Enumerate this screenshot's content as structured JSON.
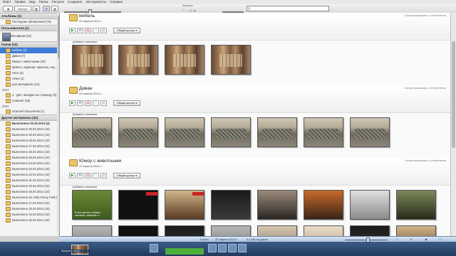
{
  "menu": [
    "Файл",
    "Правка",
    "Вид",
    "Папка",
    "Рисунок",
    "Создание",
    "Инструменты",
    "Справка"
  ],
  "toolbar": {
    "import_label": "Импорт",
    "filters_label": "Фильтры",
    "search_placeholder": ""
  },
  "sidebar": {
    "albums_header": "Альбомы (1)",
    "albums": [
      {
        "label": "Последние обновления (75)"
      }
    ],
    "people_header": "Пользователи (1)",
    "person": "Без имени (41)",
    "folders_header": "Папки (10)",
    "folders_2014": [
      {
        "label": "мебель (4)",
        "selected": true
      },
      {
        "label": "Диван (7)"
      },
      {
        "label": "Юмор с животными (40)"
      },
      {
        "label": "фейлы, падения, приколы, неу..."
      },
      {
        "label": "Ночь (4)"
      },
      {
        "label": "Vines (1)"
      },
      {
        "label": "доп материалы (21)"
      }
    ],
    "year_2013": "2013",
    "folders_2013": [
      {
        "label": "4 - Доп. вкладки на страницу (5)"
      },
      {
        "label": "планшет (93)"
      }
    ],
    "year_2004": "2004",
    "folders_2004": [
      {
        "label": "Scanned Documents (1)"
      }
    ],
    "other_header": "Другие материалы (41)",
    "other": [
      {
        "label": "Выполнено 01.05.2014 (4)",
        "bold": true
      },
      {
        "label": "Выполнено 30.04.2014 (10)"
      },
      {
        "label": "Выполнено 29.04.2014 (10)"
      },
      {
        "label": "Выполнено 28.04.2014 (10)"
      },
      {
        "label": "Выполнено 27.04.2014 (10)"
      },
      {
        "label": "Выполнено 26.04.2014 (10)"
      },
      {
        "label": "Выполнено 25.04.2014 (10)"
      },
      {
        "label": "Выполнено 24.04.2014 (10)"
      },
      {
        "label": "Выполнено 23.04.2014 (10)"
      },
      {
        "label": "Выполнено 22.04.2014 (10)"
      },
      {
        "label": "Выполнено 21.04.2014 (10)"
      },
      {
        "label": "Выполнено 20.04.2014 (10)"
      },
      {
        "label": "Выполнено 18.04.2014 (10)"
      },
      {
        "label": "Выполнено So Only Funny Fails (8)"
      },
      {
        "label": "Выполнено 17.04.2014 (10)"
      },
      {
        "label": "Выполнено 16.04.2014 (10)"
      },
      {
        "label": "Выполнено 15.04.2014 (10)"
      },
      {
        "label": "Выполнено 15.04.2014 (10)"
      }
    ]
  },
  "albums": [
    {
      "title": "мебель",
      "date": "20 апреля 2014 г.",
      "sync": "Синхронизировать с Интернетом",
      "share": "Общий доступ",
      "desc": "Добавить описание",
      "thumbs": [
        "furn",
        "furn",
        "furn",
        "furn"
      ]
    },
    {
      "title": "Диван",
      "date": "20 апреля 2014 г.",
      "sync": "Синхронизировать с Интернетом",
      "share": "Общий доступ",
      "desc": "Добавить описание",
      "thumbs": [
        "sofa",
        "sofa",
        "sofa",
        "sofa",
        "sofa",
        "sofa",
        "sofa"
      ]
    },
    {
      "title": "Юмор с животными",
      "date": "17 апреля 2014 г.",
      "sync": "Синхронизировать с Интернетом",
      "share": "Общий доступ",
      "desc": "Добавить описание",
      "green_caption": "В этих фотках собраны смешные, забавные и...",
      "thumbs": [
        "green",
        "dark",
        "pet1",
        "dark2",
        "pet2",
        "pet3",
        "pet4",
        "pet5"
      ],
      "thumbs_row2": [
        "gray",
        "dark",
        "dark2",
        "gray",
        "room",
        "pet6",
        "dark2",
        "pet1"
      ]
    }
  ],
  "status": {
    "count": "4 фото",
    "date": "20 апреля 2014 г.",
    "size": "4,3 МБ на диске"
  },
  "tray": {
    "selection_label": "Выбрано папок: 1",
    "selection_count": "1"
  },
  "colors": {
    "selected": "#3d7bd8",
    "folder": "#e9c46a",
    "statusbar": "#2c4a72"
  }
}
